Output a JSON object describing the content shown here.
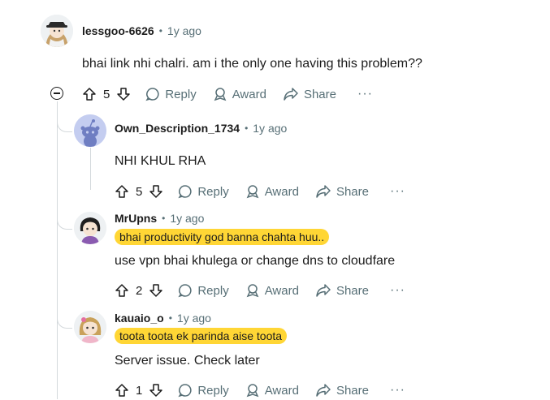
{
  "comments": [
    {
      "author": "lessgoo-6626",
      "separator": "•",
      "age": "1y ago",
      "flair": "",
      "text": "bhai link nhi chalri. am i the only one having this problem??",
      "votes": "5",
      "reply_label": "Reply",
      "award_label": "Award",
      "share_label": "Share",
      "more_label": "···",
      "avatar": "anime-girl-with-hat-avatar"
    },
    {
      "author": "Own_Description_1734",
      "separator": "•",
      "age": "1y ago",
      "flair": "",
      "text": "NHI KHUL RHA",
      "votes": "5",
      "reply_label": "Reply",
      "award_label": "Award",
      "share_label": "Share",
      "more_label": "···",
      "avatar": "default-snoo-avatar"
    },
    {
      "author": "MrUpns",
      "separator": "•",
      "age": "1y ago",
      "flair": "bhai productivity god banna chahta huu..",
      "text": "use vpn bhai khulega or change dns to cloudfare",
      "votes": "2",
      "reply_label": "Reply",
      "award_label": "Award",
      "share_label": "Share",
      "more_label": "···",
      "avatar": "anime-character-avatar"
    },
    {
      "author": "kauaio_o",
      "separator": "•",
      "age": "1y ago",
      "flair": "toota toota ek parinda aise toota",
      "text": "Server issue. Check later",
      "votes": "1",
      "reply_label": "Reply",
      "award_label": "Award",
      "share_label": "Share",
      "more_label": "···",
      "avatar": "anime-girl-avatar"
    }
  ],
  "colors": {
    "flair_bg": "#ffd635",
    "meta_text": "#576f76",
    "thread_line": "#d4d9dc",
    "text": "#1c1c1c"
  }
}
